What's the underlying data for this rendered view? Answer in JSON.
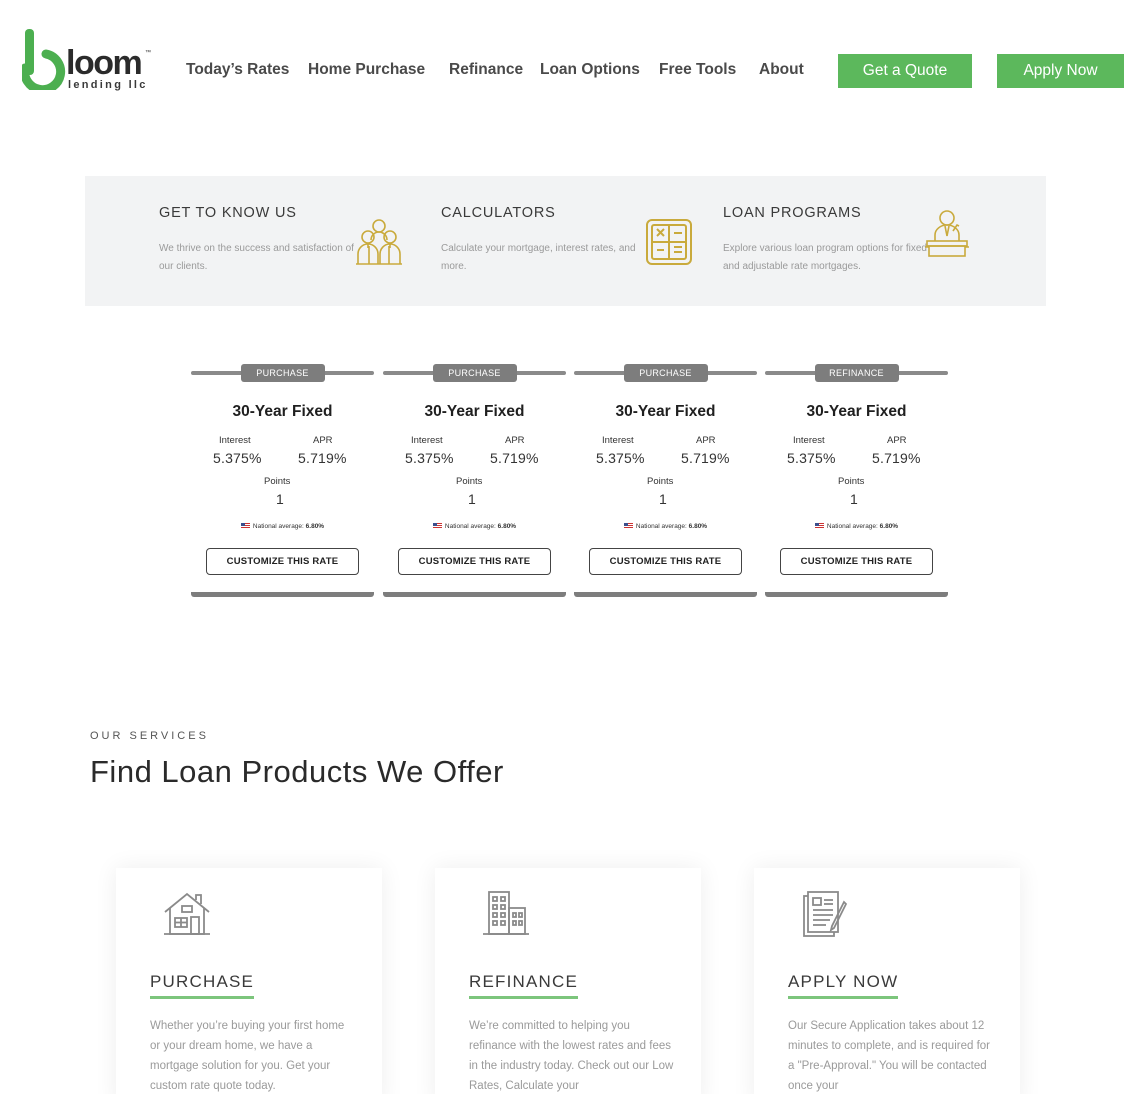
{
  "brand": {
    "name": "loom",
    "tagline": "lending llc",
    "trademark": "™",
    "accent": "#5cb85c",
    "logo_green": "#4caf50"
  },
  "nav": {
    "items": [
      "Today’s Rates",
      "Home Purchase",
      "Refinance",
      "Loan Options",
      "Free Tools",
      "About"
    ],
    "quote_label": "Get a Quote",
    "apply_label": "Apply Now"
  },
  "info": [
    {
      "title": "GET TO KNOW US",
      "desc": "We thrive on the success and satisfaction of our clients.",
      "icon": "team-icon"
    },
    {
      "title": "CALCULATORS",
      "desc": "Calculate your mortgage, interest rates, and more.",
      "icon": "calculator-icon"
    },
    {
      "title": "LOAN PROGRAMS",
      "desc": "Explore various loan program options for fixed and adjustable rate mortgages.",
      "icon": "presenter-icon"
    }
  ],
  "rates": {
    "labels": {
      "interest": "Interest",
      "apr": "APR",
      "points": "Points",
      "national": "National average:",
      "button": "CUSTOMIZE THIS RATE"
    },
    "cards": [
      {
        "tag": "PURCHASE",
        "title": "30-Year Fixed",
        "interest": "5.375%",
        "apr": "5.719%",
        "points": "1",
        "national": "6.80%"
      },
      {
        "tag": "PURCHASE",
        "title": "30-Year Fixed",
        "interest": "5.375%",
        "apr": "5.719%",
        "points": "1",
        "national": "6.80%"
      },
      {
        "tag": "PURCHASE",
        "title": "30-Year Fixed",
        "interest": "5.375%",
        "apr": "5.719%",
        "points": "1",
        "national": "6.80%"
      },
      {
        "tag": "REFINANCE",
        "title": "30-Year Fixed",
        "interest": "5.375%",
        "apr": "5.719%",
        "points": "1",
        "national": "6.80%"
      }
    ]
  },
  "services": {
    "kicker": "OUR SERVICES",
    "heading": "Find Loan Products We Offer",
    "cards": [
      {
        "title": "PURCHASE",
        "desc": "Whether you’re buying your first home or your dream home, we have a mortgage solution for you. Get your custom rate quote today.",
        "icon": "house-icon"
      },
      {
        "title": "REFINANCE",
        "desc": "We’re committed to helping you refinance with the lowest rates and fees in the industry today. Check out our Low Rates, Calculate your",
        "icon": "building-icon"
      },
      {
        "title": "APPLY NOW",
        "desc": "Our Secure Application takes about 12 minutes to complete, and is required for a \"Pre-Approval.\" You will be contacted once your",
        "icon": "application-form-icon"
      }
    ]
  }
}
